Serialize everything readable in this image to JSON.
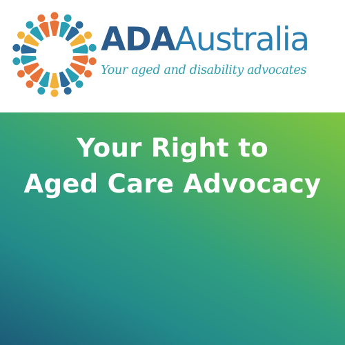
{
  "logo": {
    "icon": "circle-of-people-logo-icon",
    "name_part1": "ADA",
    "name_part2": "Australia",
    "tagline": "Your aged and disability advocates"
  },
  "headline": {
    "line1": "Your Right to",
    "line2": "Aged Care Advocacy"
  },
  "colors": {
    "logo_dark_blue": "#2a5b8a",
    "logo_blue": "#2a7fb0",
    "tagline_teal": "#2f9fb0",
    "gradient_dark": "#1c5c78",
    "gradient_teal": "#238a8a",
    "gradient_light_green": "#80c540",
    "headline_text": "#ffffff",
    "figure_orange": "#e8733a",
    "figure_teal": "#2a9fb3",
    "figure_blue": "#2b6a9b",
    "figure_yellow": "#f1b23c"
  }
}
